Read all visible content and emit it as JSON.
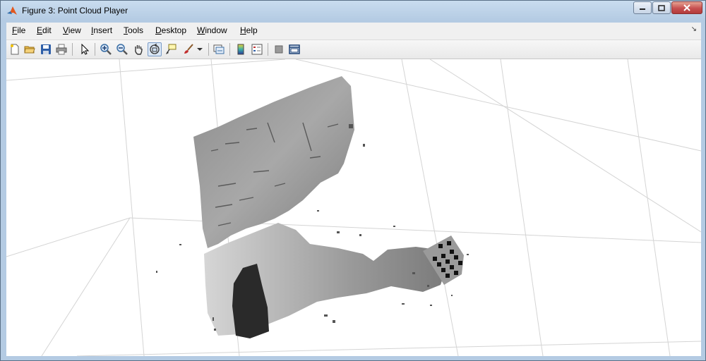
{
  "window": {
    "title": "Figure 3: Point Cloud Player"
  },
  "menu": {
    "items": [
      "File",
      "Edit",
      "View",
      "Insert",
      "Tools",
      "Desktop",
      "Window",
      "Help"
    ]
  },
  "toolbar": {
    "buttons": [
      {
        "name": "new-figure",
        "icon": "new-file-icon"
      },
      {
        "name": "open-file",
        "icon": "folder-open-icon"
      },
      {
        "name": "save-figure",
        "icon": "save-icon"
      },
      {
        "name": "print-figure",
        "icon": "printer-icon"
      },
      {
        "name": "edit-plot",
        "icon": "pointer-icon"
      },
      {
        "name": "zoom-in",
        "icon": "zoom-in-icon"
      },
      {
        "name": "zoom-out",
        "icon": "zoom-out-icon"
      },
      {
        "name": "pan",
        "icon": "hand-icon"
      },
      {
        "name": "rotate-3d",
        "icon": "rotate-3d-icon",
        "active": true
      },
      {
        "name": "data-cursor",
        "icon": "data-cursor-icon"
      },
      {
        "name": "brush",
        "icon": "brush-icon"
      },
      {
        "name": "link-plot",
        "icon": "link-plot-icon"
      },
      {
        "name": "insert-colorbar",
        "icon": "colorbar-icon"
      },
      {
        "name": "insert-legend",
        "icon": "legend-icon"
      },
      {
        "name": "hide-plot-tools",
        "icon": "hide-plot-tools-icon"
      },
      {
        "name": "show-plot-tools",
        "icon": "show-plot-tools-icon"
      }
    ]
  },
  "colors": {
    "accent": "#3a6ea5",
    "close": "#c75050",
    "background": "#ffffff",
    "grid": "#d4d4d4"
  }
}
